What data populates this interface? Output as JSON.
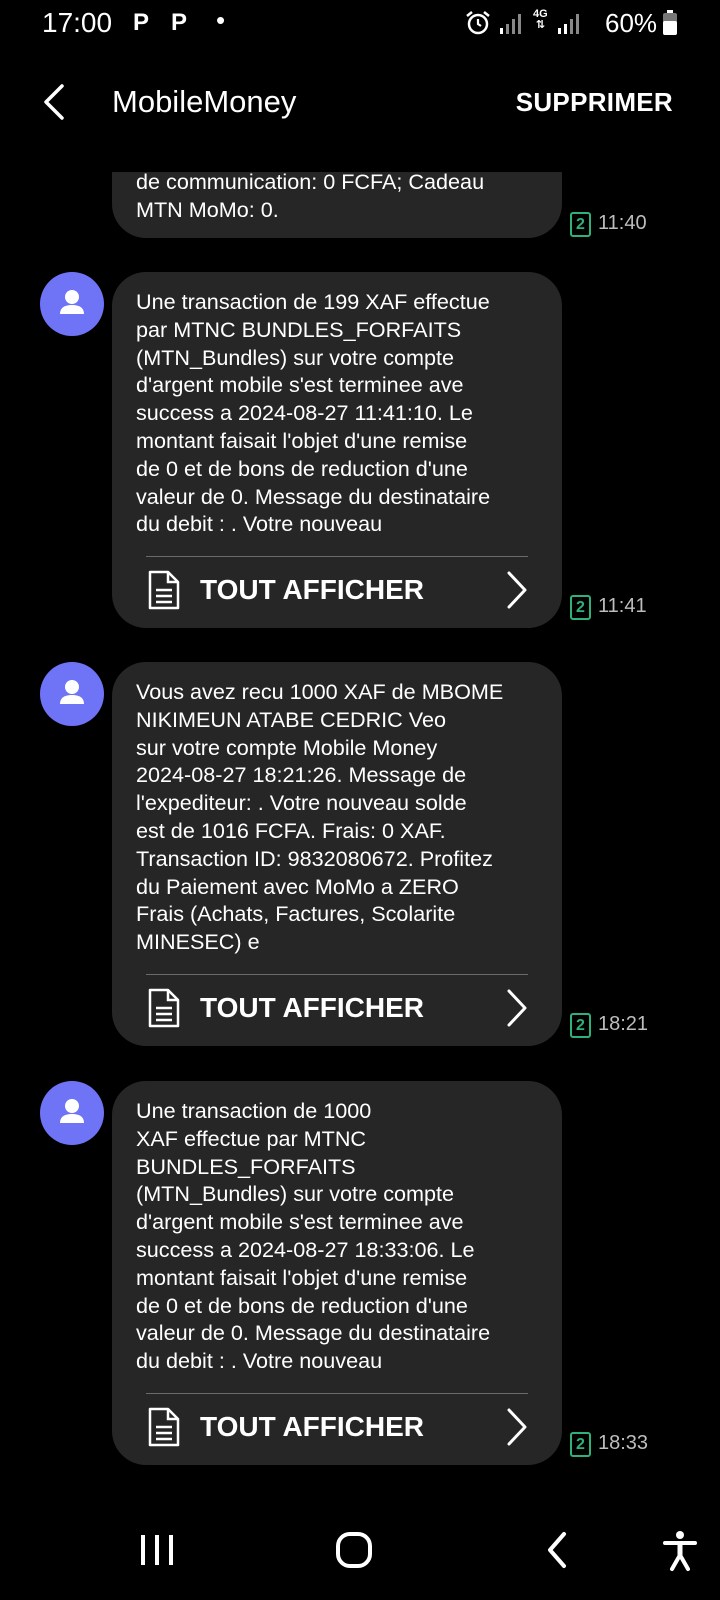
{
  "status_bar": {
    "time": "17:00",
    "notification_icons": [
      "P",
      "P"
    ],
    "dot": "•",
    "network": "4G",
    "battery": "60%"
  },
  "header": {
    "title": "MobileMoney",
    "delete_label": "SUPPRIMER",
    "back_icon": "chevron-left-icon"
  },
  "messages": [
    {
      "text": "de communication: 0 FCFA; Cadeau\nMTN MoMo: 0.",
      "sim": "2",
      "time": "11:40"
    },
    {
      "text": "Une transaction de 199 XAF effectue\npar MTNC BUNDLES_FORFAITS\n(MTN_Bundles) sur votre compte\nd'argent mobile s'est terminee ave\nsuccess a 2024-08-27 11:41:10. Le\nmontant faisait l'objet d'une remise\nde 0 et de bons de reduction d'une\nvaleur de 0. Message du destinataire\ndu debit : . Votre nouveau",
      "view_all": "TOUT AFFICHER",
      "sim": "2",
      "time": "11:41"
    },
    {
      "text": "Vous avez recu 1000 XAF de MBOME\nNIKIMEUN ATABE CEDRIC Veo\nsur votre compte Mobile Money\n2024-08-27 18:21:26. Message de\nl'expediteur: . Votre nouveau solde\nest de 1016 FCFA. Frais: 0 XAF.\nTransaction ID: 9832080672. Profitez\ndu Paiement avec MoMo a ZERO\nFrais (Achats, Factures, Scolarite\nMINESEC) e",
      "view_all": "TOUT AFFICHER",
      "sim": "2",
      "time": "18:21"
    },
    {
      "text": "Une transaction de 1000\nXAF effectue par MTNC\nBUNDLES_FORFAITS\n(MTN_Bundles) sur votre compte\nd'argent mobile s'est terminee ave\nsuccess a 2024-08-27 18:33:06. Le\nmontant faisait l'objet d'une remise\nde 0 et de bons de reduction d'une\nvaleur de 0. Message du destinataire\ndu debit : . Votre nouveau",
      "view_all": "TOUT AFFICHER",
      "sim": "2",
      "time": "18:33"
    }
  ],
  "colors": {
    "background": "#000000",
    "bubble": "#262626",
    "avatar": "#6f73f5",
    "sim_badge": "#2fb27a",
    "time_text": "#bdbdbd"
  },
  "nav_bar": {
    "items": [
      "recent-apps-icon",
      "home-icon",
      "back-icon",
      "accessibility-icon"
    ]
  }
}
